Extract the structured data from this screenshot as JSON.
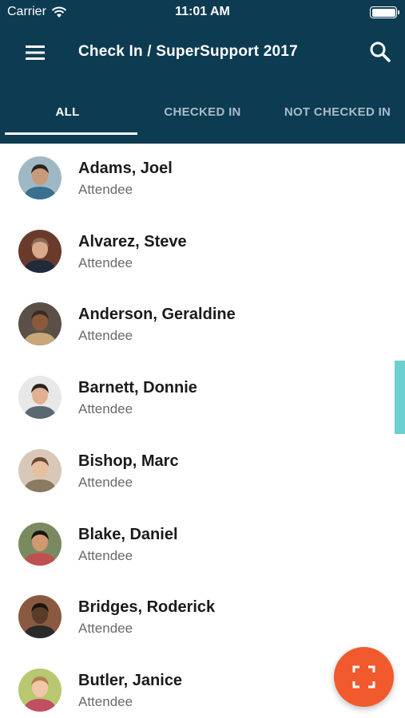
{
  "status_bar": {
    "carrier": "Carrier",
    "time": "11:01 AM"
  },
  "app_bar": {
    "title": "Check In / SuperSupport 2017",
    "menu_icon": "menu-icon",
    "search_icon": "search-icon"
  },
  "tabs": [
    {
      "label": "ALL",
      "active": true
    },
    {
      "label": "CHECKED IN",
      "active": false
    },
    {
      "label": "NOT CHECKED IN",
      "active": false
    }
  ],
  "attendees": [
    {
      "name": "Adams, Joel",
      "role": "Attendee",
      "skin": "#c89a7a",
      "hair": "#2a2420",
      "shirt": "#3a6f8f",
      "bg": "#9fb8c4"
    },
    {
      "name": "Alvarez, Steve",
      "role": "Attendee",
      "skin": "#d8a98a",
      "hair": "#8a6a50",
      "shirt": "#1f2a3a",
      "bg": "#6a3a2a"
    },
    {
      "name": "Anderson, Geraldine",
      "role": "Attendee",
      "skin": "#8a5a3a",
      "hair": "#3a2a20",
      "shirt": "#c8a878",
      "bg": "#5a5048"
    },
    {
      "name": "Barnett, Donnie",
      "role": "Attendee",
      "skin": "#e0b090",
      "hair": "#2a2420",
      "shirt": "#5a6870",
      "bg": "#e8e8e8"
    },
    {
      "name": "Bishop, Marc",
      "role": "Attendee",
      "skin": "#e8c0a0",
      "hair": "#6a4a30",
      "shirt": "#8a7a60",
      "bg": "#d8c8b8"
    },
    {
      "name": "Blake, Daniel",
      "role": "Attendee",
      "skin": "#d09a70",
      "hair": "#1a1410",
      "shirt": "#c05050",
      "bg": "#7a8a60"
    },
    {
      "name": "Bridges, Roderick",
      "role": "Attendee",
      "skin": "#5a3a28",
      "hair": "#1a1410",
      "shirt": "#2a2a2a",
      "bg": "#8a5a40"
    },
    {
      "name": "Butler, Janice",
      "role": "Attendee",
      "skin": "#f0c8a8",
      "hair": "#b08050",
      "shirt": "#c05060",
      "bg": "#b8c870"
    }
  ],
  "fab": {
    "icon": "scan-icon",
    "color": "#f15a2d"
  },
  "colors": {
    "header": "#0d3b52",
    "scroll_thumb": "#6ccfd0",
    "tab_inactive": "#a9bcc8"
  }
}
